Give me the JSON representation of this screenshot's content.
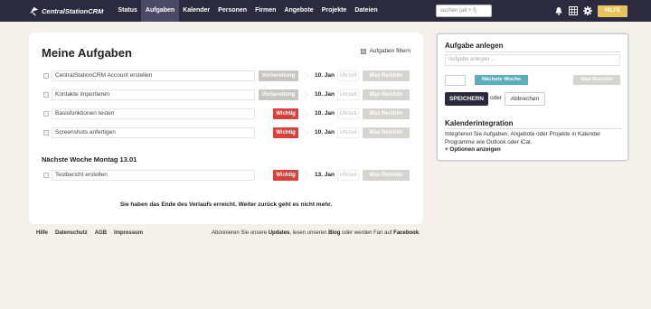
{
  "header": {
    "logo_text": "CentralStationCRM",
    "nav": [
      "Status",
      "Aufgaben",
      "Kalender",
      "Personen",
      "Firmen",
      "Angebote",
      "Projekte",
      "Dateien"
    ],
    "active_nav": "Aufgaben",
    "search_placeholder": "suchen (alt + f)",
    "help_label": "HILFE",
    "icons": [
      "bell-icon",
      "calendar-grid-icon",
      "gear-icon"
    ]
  },
  "main": {
    "title": "Meine Aufgaben",
    "filter_label": "Aufgaben filtern",
    "tasks": [
      {
        "text": "CentralStationCRM Account erstellen",
        "status": "Vorbereitung",
        "date": "10. Jan",
        "time_placeholder": "Uhrzeit",
        "action": "Max Reichlin"
      },
      {
        "text": "Kontakte importieren",
        "status": "Vorbereitung",
        "date": "10. Jan",
        "time_placeholder": "Uhrzeit",
        "action": "Max Reichlin"
      },
      {
        "text": "Basisfunktionen testen",
        "status": "Wichtig",
        "date": "10. Jan",
        "time_placeholder": "Uhrzeit",
        "action": "Max Reichlin"
      },
      {
        "text": "Screenshots anfertigen",
        "status": "Wichtig",
        "date": "10. Jan",
        "time_placeholder": "Uhrzeit",
        "action": "Max Reichlin"
      }
    ],
    "next_week_heading": "Nächste Woche Montag 13.01",
    "next_week_tasks": [
      {
        "text": "Testbericht erstellen",
        "status": "Wichtig",
        "date": "13. Jan",
        "time_placeholder": "Uhrzeit",
        "action": "Max Reichlin"
      }
    ],
    "end_message": "Sie haben das Ende des Verlaufs erreicht. Weiter zurück geht es nicht mehr.",
    "colors": {
      "vorbereitung": "#c8c6c1",
      "wichtig": "#d9403a"
    }
  },
  "sidebar": {
    "create_heading": "Aufgabe anlegen",
    "task_placeholder": "Aufgabe anlegen ...",
    "next_week_button": "Nächste Woche",
    "assignee_button": "Max Reichlin",
    "save_button": "SPEICHERN",
    "or_text": "oder",
    "cancel_button": "Abbrechen",
    "calendar_heading": "Kalenderintegration",
    "calendar_text": "Integrieren Sie Aufgaben, Angebote oder Projekte in Kalender Programme wie Outlook oder iCal.",
    "more_options": "+ Optionen anzeigen"
  },
  "footer": {
    "links": [
      "Hilfe",
      "Datenschutz",
      "AGB",
      "Impressum"
    ],
    "sep": "·",
    "text_1": "Abonnieren Sie unsere",
    "updates": "Updates",
    "text_2": ", lesen unseren",
    "blog": "Blog",
    "text_3": "oder werden Fan auf",
    "facebook": "Facebook",
    "text_4": "."
  }
}
